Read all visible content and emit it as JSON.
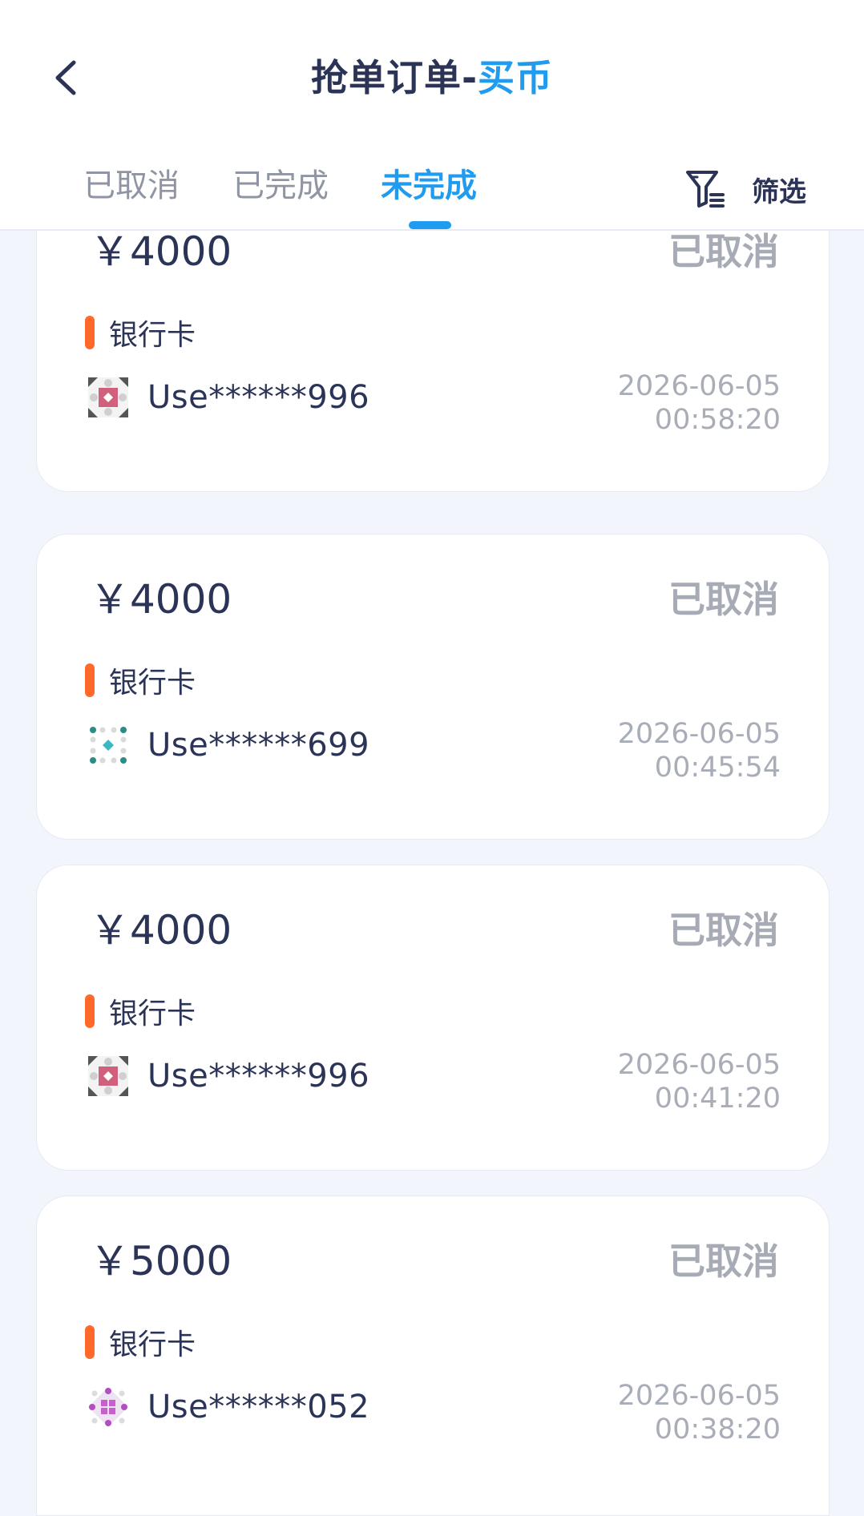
{
  "header": {
    "title_prefix": "抢单订单-",
    "title_accent": "买币",
    "back_icon": "chevron-left-icon"
  },
  "tabs": [
    {
      "label": "已取消",
      "active": false
    },
    {
      "label": "已完成",
      "active": false
    },
    {
      "label": "未完成",
      "active": true
    }
  ],
  "filter": {
    "label": "筛选",
    "icon": "funnel-filter-icon"
  },
  "colors": {
    "accent": "#1f9cf0",
    "payment_marker": "#ff6a2b",
    "status_text": "#a7abb5"
  },
  "orders": [
    {
      "amount": "￥4000",
      "status": "已取消",
      "method": "银行卡",
      "user": "Use******996",
      "date": "2026-06-05",
      "time": "00:58:20",
      "avatar": "pink-identicon"
    },
    {
      "amount": "￥4000",
      "status": "已取消",
      "method": "银行卡",
      "user": "Use******699",
      "date": "2026-06-05",
      "time": "00:45:54",
      "avatar": "teal-identicon"
    },
    {
      "amount": "￥4000",
      "status": "已取消",
      "method": "银行卡",
      "user": "Use******996",
      "date": "2026-06-05",
      "time": "00:41:20",
      "avatar": "pink-identicon"
    },
    {
      "amount": "￥5000",
      "status": "已取消",
      "method": "银行卡",
      "user": "Use******052",
      "date": "2026-06-05",
      "time": "00:38:20",
      "avatar": "purple-identicon"
    }
  ]
}
